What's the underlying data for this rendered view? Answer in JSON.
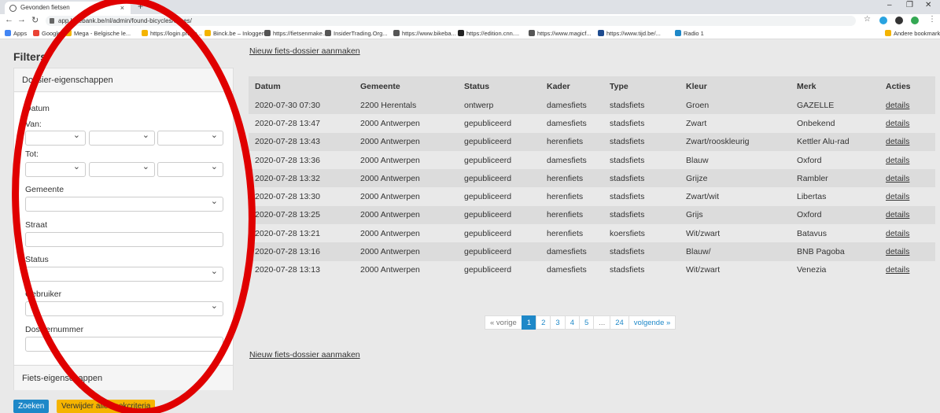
{
  "browser": {
    "tab_title": "Gevonden fietsen",
    "tab_close": "×",
    "new_tab": "+",
    "url": "app.bikebank.be/nl/admin/found-bicycles/cases/",
    "window_controls": [
      "–",
      "❐",
      "✕"
    ],
    "bookmarks": [
      {
        "label": "Apps",
        "color": "#4285f4"
      },
      {
        "label": "Google",
        "color": "#ea4335"
      },
      {
        "label": "Mega - Belgische le...",
        "color": "#f4b400"
      },
      {
        "label": "https://login.prd.te...",
        "color": "#f4b400"
      },
      {
        "label": "Binck.be – Inloggen",
        "color": "#f4b400"
      },
      {
        "label": "https://fietsenmake...",
        "color": "#555555"
      },
      {
        "label": "InsiderTrading.Org...",
        "color": "#555555"
      },
      {
        "label": "https://www.bikeba...",
        "color": "#555555"
      },
      {
        "label": "https://edition.cnn....",
        "color": "#222222"
      },
      {
        "label": "https://www.magicf...",
        "color": "#555555"
      },
      {
        "label": "https://www.tijd.be/...",
        "color": "#1e4b8f"
      },
      {
        "label": "Radio 1",
        "color": "#1e88c8"
      }
    ],
    "other_bookmarks": "Andere bookmarks"
  },
  "filters": {
    "title": "Filters:",
    "section1_title": "Dossier-eigenschappen",
    "datum_label": "Datum",
    "van_label": "Van:",
    "tot_label": "Tot:",
    "gemeente_label": "Gemeente",
    "straat_label": "Straat",
    "status_label": "Status",
    "gebruiker_label": "Gebruiker",
    "dossiernummer_label": "Dossiernummer",
    "section2_title": "Fiets-eigenschappen",
    "search_button": "Zoeken",
    "clear_button": "Verwijder alle zoekcriteria"
  },
  "links": {
    "new_case_top": "Nieuw fiets-dossier aanmaken",
    "new_case_bottom": "Nieuw fiets-dossier aanmaken"
  },
  "table": {
    "headers": [
      "Datum",
      "Gemeente",
      "Status",
      "Kader",
      "Type",
      "Kleur",
      "Merk",
      "Acties"
    ],
    "rows": [
      [
        "2020-07-30 07:30",
        "2200 Herentals",
        "ontwerp",
        "damesfiets",
        "stadsfiets",
        "Groen",
        "GAZELLE",
        "details"
      ],
      [
        "2020-07-28 13:47",
        "2000 Antwerpen",
        "gepubliceerd",
        "damesfiets",
        "stadsfiets",
        "Zwart",
        "Onbekend",
        "details"
      ],
      [
        "2020-07-28 13:43",
        "2000 Antwerpen",
        "gepubliceerd",
        "herenfiets",
        "stadsfiets",
        "Zwart/rooskleurig",
        "Kettler Alu-rad",
        "details"
      ],
      [
        "2020-07-28 13:36",
        "2000 Antwerpen",
        "gepubliceerd",
        "damesfiets",
        "stadsfiets",
        "Blauw",
        "Oxford",
        "details"
      ],
      [
        "2020-07-28 13:32",
        "2000 Antwerpen",
        "gepubliceerd",
        "herenfiets",
        "stadsfiets",
        "Grijze",
        "Rambler",
        "details"
      ],
      [
        "2020-07-28 13:30",
        "2000 Antwerpen",
        "gepubliceerd",
        "herenfiets",
        "stadsfiets",
        "Zwart/wit",
        "Libertas",
        "details"
      ],
      [
        "2020-07-28 13:25",
        "2000 Antwerpen",
        "gepubliceerd",
        "herenfiets",
        "stadsfiets",
        "Grijs",
        "Oxford",
        "details"
      ],
      [
        "2020-07-28 13:21",
        "2000 Antwerpen",
        "gepubliceerd",
        "herenfiets",
        "koersfiets",
        "Wit/zwart",
        "Batavus",
        "details"
      ],
      [
        "2020-07-28 13:16",
        "2000 Antwerpen",
        "gepubliceerd",
        "damesfiets",
        "stadsfiets",
        "Blauw/",
        "BNB Pagoba",
        "details"
      ],
      [
        "2020-07-28 13:13",
        "2000 Antwerpen",
        "gepubliceerd",
        "damesfiets",
        "stadsfiets",
        "Wit/zwart",
        "Venezia",
        "details"
      ]
    ]
  },
  "pagination": {
    "prev": "« vorige",
    "pages": [
      "1",
      "2",
      "3",
      "4",
      "5",
      "...",
      "24"
    ],
    "active": "1",
    "next": "volgende »"
  },
  "colors": {
    "accent": "#1e88c8",
    "warning": "#f5b400",
    "annotation": "#e00000"
  }
}
